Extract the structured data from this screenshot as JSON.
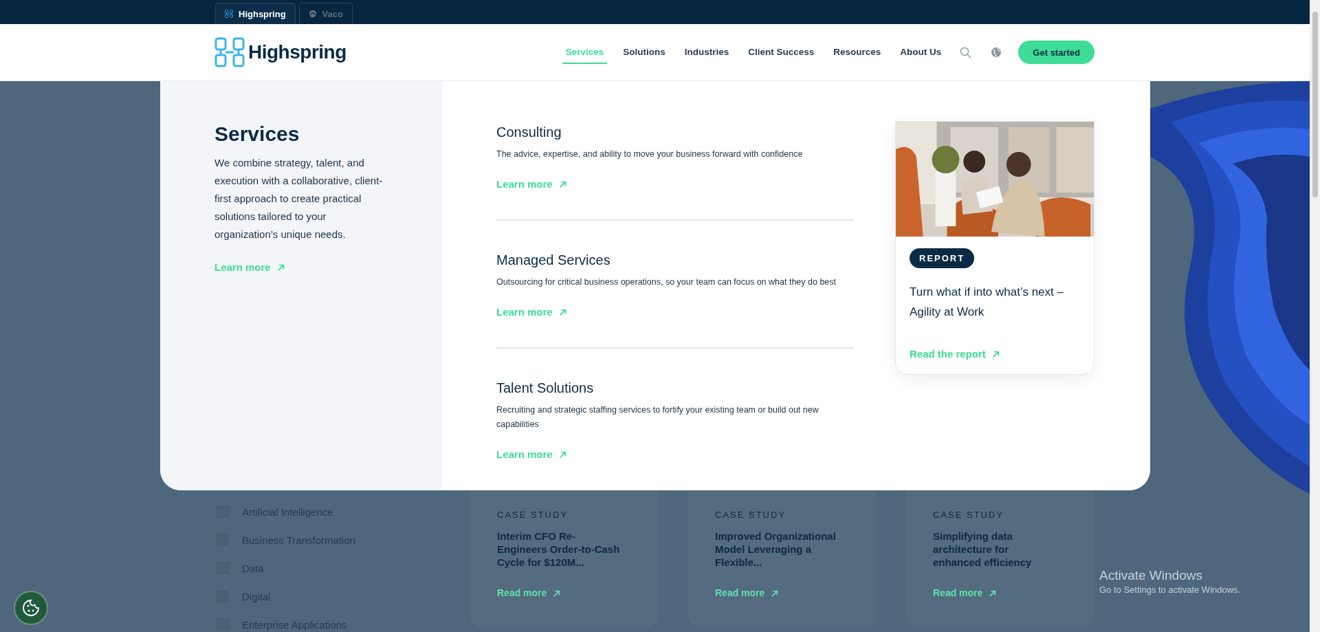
{
  "top_tabs": [
    {
      "label": "Highspring",
      "selected": true
    },
    {
      "label": "Vaco",
      "selected": false
    }
  ],
  "header": {
    "logo": "Highspring",
    "nav": [
      {
        "label": "Services",
        "selected": true
      },
      {
        "label": "Solutions",
        "selected": false
      },
      {
        "label": "Industries",
        "selected": false
      },
      {
        "label": "Client Success",
        "selected": false
      },
      {
        "label": "Resources",
        "selected": false
      },
      {
        "label": "About Us",
        "selected": false
      }
    ],
    "cta": "Get started"
  },
  "menu": {
    "title": "Services",
    "description": "We combine strategy, talent, and execution with a collaborative, client-first approach to create practical solutions tailored to your organization’s unique needs.",
    "link": "Learn more",
    "items": [
      {
        "title": "Consulting",
        "description": "The advice, expertise, and ability to move your business forward with confidence",
        "link": "Learn more"
      },
      {
        "title": "Managed Services",
        "description": "Outsourcing for critical business operations, so your team can focus on what they do best",
        "link": "Learn more"
      },
      {
        "title": "Talent Solutions",
        "description": "Recruiting and strategic staffing services to fortify your existing team or build out new capabilities",
        "link": "Learn more"
      }
    ],
    "feature": {
      "tag": "REPORT",
      "title": "Turn what if into what’s next – Agility at Work",
      "link": "Read the report"
    }
  },
  "filters": [
    {
      "label": "Artificial Intelligence",
      "checked": false
    },
    {
      "label": "Business Transformation",
      "checked": false
    },
    {
      "label": "Data",
      "checked": false
    },
    {
      "label": "Digital",
      "checked": false
    },
    {
      "label": "Enterprise Applications",
      "checked": false
    }
  ],
  "case_studies": [
    {
      "label": "CASE STUDY",
      "title": "Interim CFO Re-Engineers Order-to-Cash Cycle for $120M...",
      "link": "Read more"
    },
    {
      "label": "CASE STUDY",
      "title": "Improved Organizational Model Leveraging a Flexible...",
      "link": "Read more"
    },
    {
      "label": "CASE STUDY",
      "title": "Simplifying data architecture for enhanced efficiency",
      "link": "Read more"
    }
  ],
  "os_notice": {
    "title": "Activate Windows",
    "text": "Go to Settings to activate Windows."
  }
}
